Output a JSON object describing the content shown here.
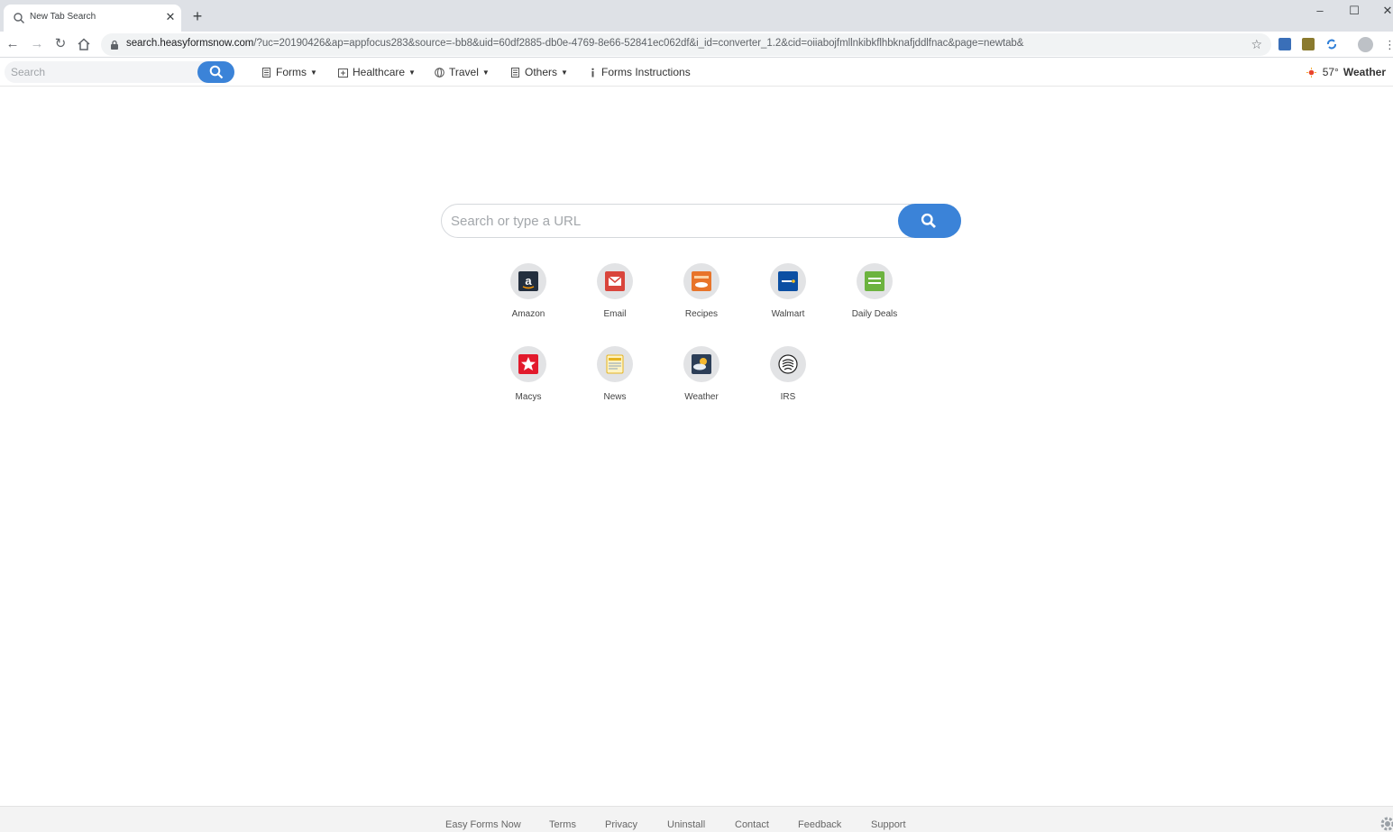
{
  "browser": {
    "tab_title": "New Tab Search",
    "url_host": "search.heasyformsnow.com",
    "url_rest": "/?uc=20190426&ap=appfocus283&source=-bb8&uid=60df2885-db0e-4769-8e66-52841ec062df&i_id=converter_1.2&cid=oiiabojfmllnkibkflhbknafjddlfnac&page=newtab&"
  },
  "header": {
    "search_placeholder": "Search",
    "menus": [
      {
        "label": "Forms",
        "icon": "document-icon"
      },
      {
        "label": "Healthcare",
        "icon": "medical-icon"
      },
      {
        "label": "Travel",
        "icon": "globe-icon"
      },
      {
        "label": "Others",
        "icon": "document-icon"
      },
      {
        "label": "Forms Instructions",
        "icon": "info-icon"
      }
    ],
    "weather_temp": "57°",
    "weather_label": "Weather"
  },
  "main": {
    "search_placeholder": "Search or type a URL"
  },
  "tiles": [
    {
      "label": "Amazon",
      "icon": "amazon-icon"
    },
    {
      "label": "Email",
      "icon": "email-icon"
    },
    {
      "label": "Recipes",
      "icon": "recipes-icon"
    },
    {
      "label": "Walmart",
      "icon": "walmart-icon"
    },
    {
      "label": "Daily Deals",
      "icon": "deals-icon"
    },
    {
      "label": "Macys",
      "icon": "macys-icon"
    },
    {
      "label": "News",
      "icon": "news-icon"
    },
    {
      "label": "Weather",
      "icon": "weather-icon"
    },
    {
      "label": "IRS",
      "icon": "irs-icon"
    }
  ],
  "footer": {
    "links": [
      "Easy Forms Now",
      "Terms",
      "Privacy",
      "Uninstall",
      "Contact",
      "Feedback",
      "Support"
    ]
  },
  "colors": {
    "accent": "#3b83d8",
    "tabstrip": "#dee1e6"
  }
}
